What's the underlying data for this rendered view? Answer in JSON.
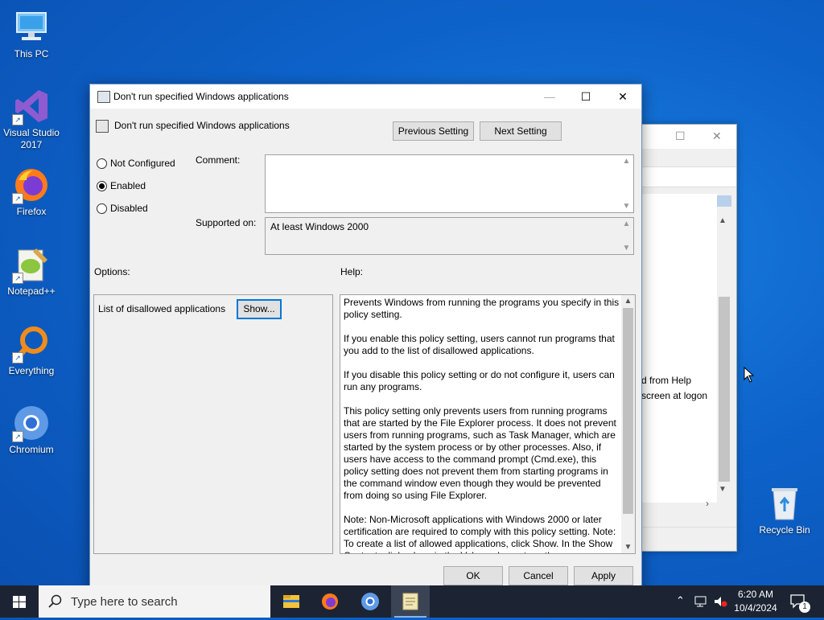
{
  "desktop": {
    "icons": [
      {
        "label": "This PC"
      },
      {
        "label": "Visual Studio 2017"
      },
      {
        "label": "Firefox"
      },
      {
        "label": "Notepad++"
      },
      {
        "label": "Everything"
      },
      {
        "label": "Chromium"
      },
      {
        "label": "Recycle Bin"
      }
    ]
  },
  "bg_window": {
    "line1": "d from Help",
    "line2": "screen at logon"
  },
  "dialog": {
    "title": "Don't run specified Windows applications",
    "header_title": "Don't run specified Windows applications",
    "prev_button": "Previous Setting",
    "next_button": "Next Setting",
    "radios": [
      {
        "label": "Not Configured",
        "selected": false
      },
      {
        "label": "Enabled",
        "selected": true
      },
      {
        "label": "Disabled",
        "selected": false
      }
    ],
    "comment_label": "Comment:",
    "comment_value": "",
    "supported_label": "Supported on:",
    "supported_value": "At least Windows 2000",
    "options_label": "Options:",
    "help_label": "Help:",
    "option_item_label": "List of disallowed applications",
    "show_button": "Show...",
    "help_paragraphs": [
      "Prevents Windows from running the programs you specify in this policy setting.",
      "If you enable this policy setting, users cannot run programs that you add to the list of disallowed applications.",
      "If you disable this policy setting or do not configure it, users can run any programs.",
      "This policy setting only prevents users from running programs that are started by the File Explorer process. It does not prevent users from running programs, such as Task Manager, which are started by the system process or by other processes.  Also, if users have access to the command prompt (Cmd.exe), this policy setting does not prevent them from starting programs in the command window even though they would be prevented from doing so using File Explorer.",
      "Note: Non-Microsoft applications with Windows 2000 or later certification are required to comply with this policy setting. Note: To create a list of allowed applications, click Show.  In the Show Contents dialog box, in the Value column, type the"
    ],
    "ok_button": "OK",
    "cancel_button": "Cancel",
    "apply_button": "Apply"
  },
  "taskbar": {
    "search_placeholder": "Type here to search",
    "time": "6:20 AM",
    "date": "10/4/2024",
    "notification_count": "1"
  }
}
